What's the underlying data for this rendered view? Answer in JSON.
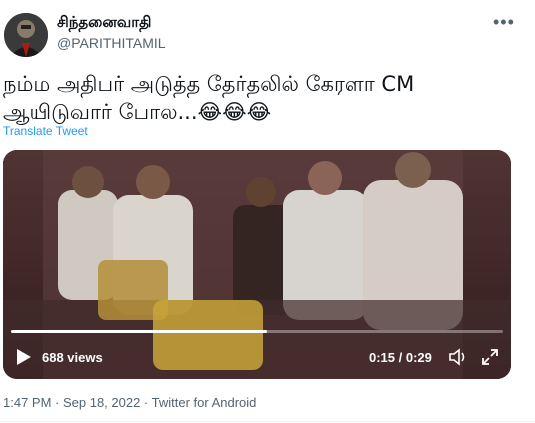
{
  "tweet": {
    "display_name": "சிந்தனைவாதி",
    "handle": "@PARITHITAMIL",
    "more_icon": "more-horizontal-icon",
    "text_line1": "நம்ம அதிபர் அடுத்த தேர்தலில் கேரளா CM",
    "text_line2": "ஆயிடுவார் போல...😂😂😂",
    "translate_label": "Translate Tweet",
    "link_color": "#1d9bf0"
  },
  "video": {
    "views": "688 views",
    "time": "0:15 / 0:29",
    "progress": 0.52,
    "play_icon": "play-icon",
    "volume_icon": "volume-icon",
    "fullscreen_icon": "fullscreen-icon"
  },
  "meta": {
    "timestamp": "1:47 PM · Sep 18, 2022 · Twitter for Android"
  }
}
